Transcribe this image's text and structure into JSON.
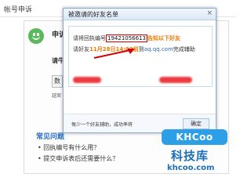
{
  "page": {
    "title": "帐号申诉"
  },
  "background": {
    "apply_label": "申诉",
    "please_label": "请牛",
    "button_label": "数",
    "note_text": "越案",
    "faq_title": "常见问题",
    "faq_items": [
      "回执编号有什么用？",
      "提交申诉表后还需要什么？"
    ]
  },
  "dialog": {
    "title": "被邀请的好友名单",
    "close_glyph": "×",
    "line1_prefix": "请将回执编号",
    "receipt_number": "19421056613",
    "line1_suffix": "告知以下好友",
    "line2_prefix": "请好友",
    "deadline": "11月28日14:02前",
    "line2_mid": "到",
    "site": "aq.qq.com",
    "line2_suffix": "完成辅助",
    "footer_text": "每少一个好友辅助，成功率将",
    "ok_label": "确定"
  },
  "watermark": {
    "badge": "KHCoo",
    "cn": "科技库",
    "url": "khcoo.com"
  },
  "colors": {
    "highlight": "#d20000",
    "accent": "#ef7a00",
    "link": "#2a6ebd",
    "brand": "#2c9fe6"
  }
}
